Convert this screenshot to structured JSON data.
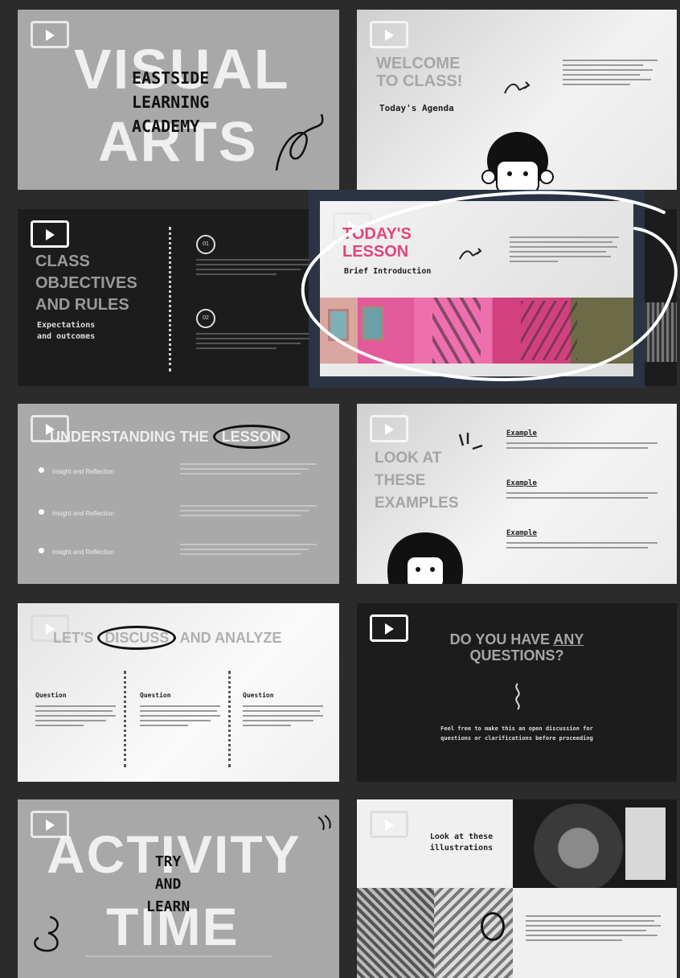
{
  "slides": [
    {
      "id": "visual-arts",
      "big_top": "VISUAL",
      "big_bottom": "ARTS",
      "overlay_lines": [
        "EASTSIDE",
        "LEARNING",
        "ACADEMY"
      ]
    },
    {
      "id": "welcome",
      "title_lines": [
        "WELCOME",
        "TO CLASS!"
      ],
      "subtitle": "Today's Agenda"
    },
    {
      "id": "objectives",
      "title_lines": [
        "CLASS",
        "OBJECTIVES",
        "AND RULES"
      ],
      "subtitle_lines": [
        "Expectations",
        "and outcomes"
      ],
      "badges": [
        "01",
        "02"
      ]
    },
    {
      "id": "todays-lesson",
      "title_lines": [
        "TODAY'S",
        "LESSON"
      ],
      "subtitle": "Brief Introduction"
    },
    {
      "id": "understanding",
      "title_prefix": "UNDERSTANDING THE",
      "title_highlight": "LESSON",
      "bullets": [
        "Insight and Reflection",
        "Insight and Reflection",
        "Insight and Reflection"
      ]
    },
    {
      "id": "examples",
      "title_lines": [
        "LOOK AT",
        "THESE",
        "EXAMPLES"
      ],
      "example_labels": [
        "Example",
        "Example",
        "Example"
      ]
    },
    {
      "id": "discuss",
      "title_prefix": "LET'S",
      "title_highlight": "DISCUSS",
      "title_suffix": "AND ANALYZE",
      "column_heads": [
        "Question",
        "Question",
        "Question"
      ]
    },
    {
      "id": "questions",
      "title_line1_prefix": "DO YOU HAVE",
      "title_line1_highlight": "ANY",
      "title_line2": "QUESTIONS?",
      "body_lines": [
        "Feel free to make this an open discussion for",
        "questions or clarifications before proceeding"
      ]
    },
    {
      "id": "activity",
      "big_top": "ACTIVITY",
      "big_bottom": "TIME",
      "overlay_lines": [
        "TRY",
        "AND",
        "LEARN"
      ]
    },
    {
      "id": "illustrations",
      "caption_lines": [
        "Look at these",
        "illustrations"
      ]
    }
  ],
  "icons": {
    "play": "play-button-icon",
    "squiggle": "squiggle-doodle-icon",
    "arrow": "arrow-doodle-icon",
    "face": "character-face-icon"
  },
  "colors": {
    "background": "#2b2b2b",
    "slide_gray": "#a9a9a9",
    "slide_dark": "#1c1c1c",
    "accent_pink": "#e0457e",
    "selection_frame": "#2a3444"
  }
}
